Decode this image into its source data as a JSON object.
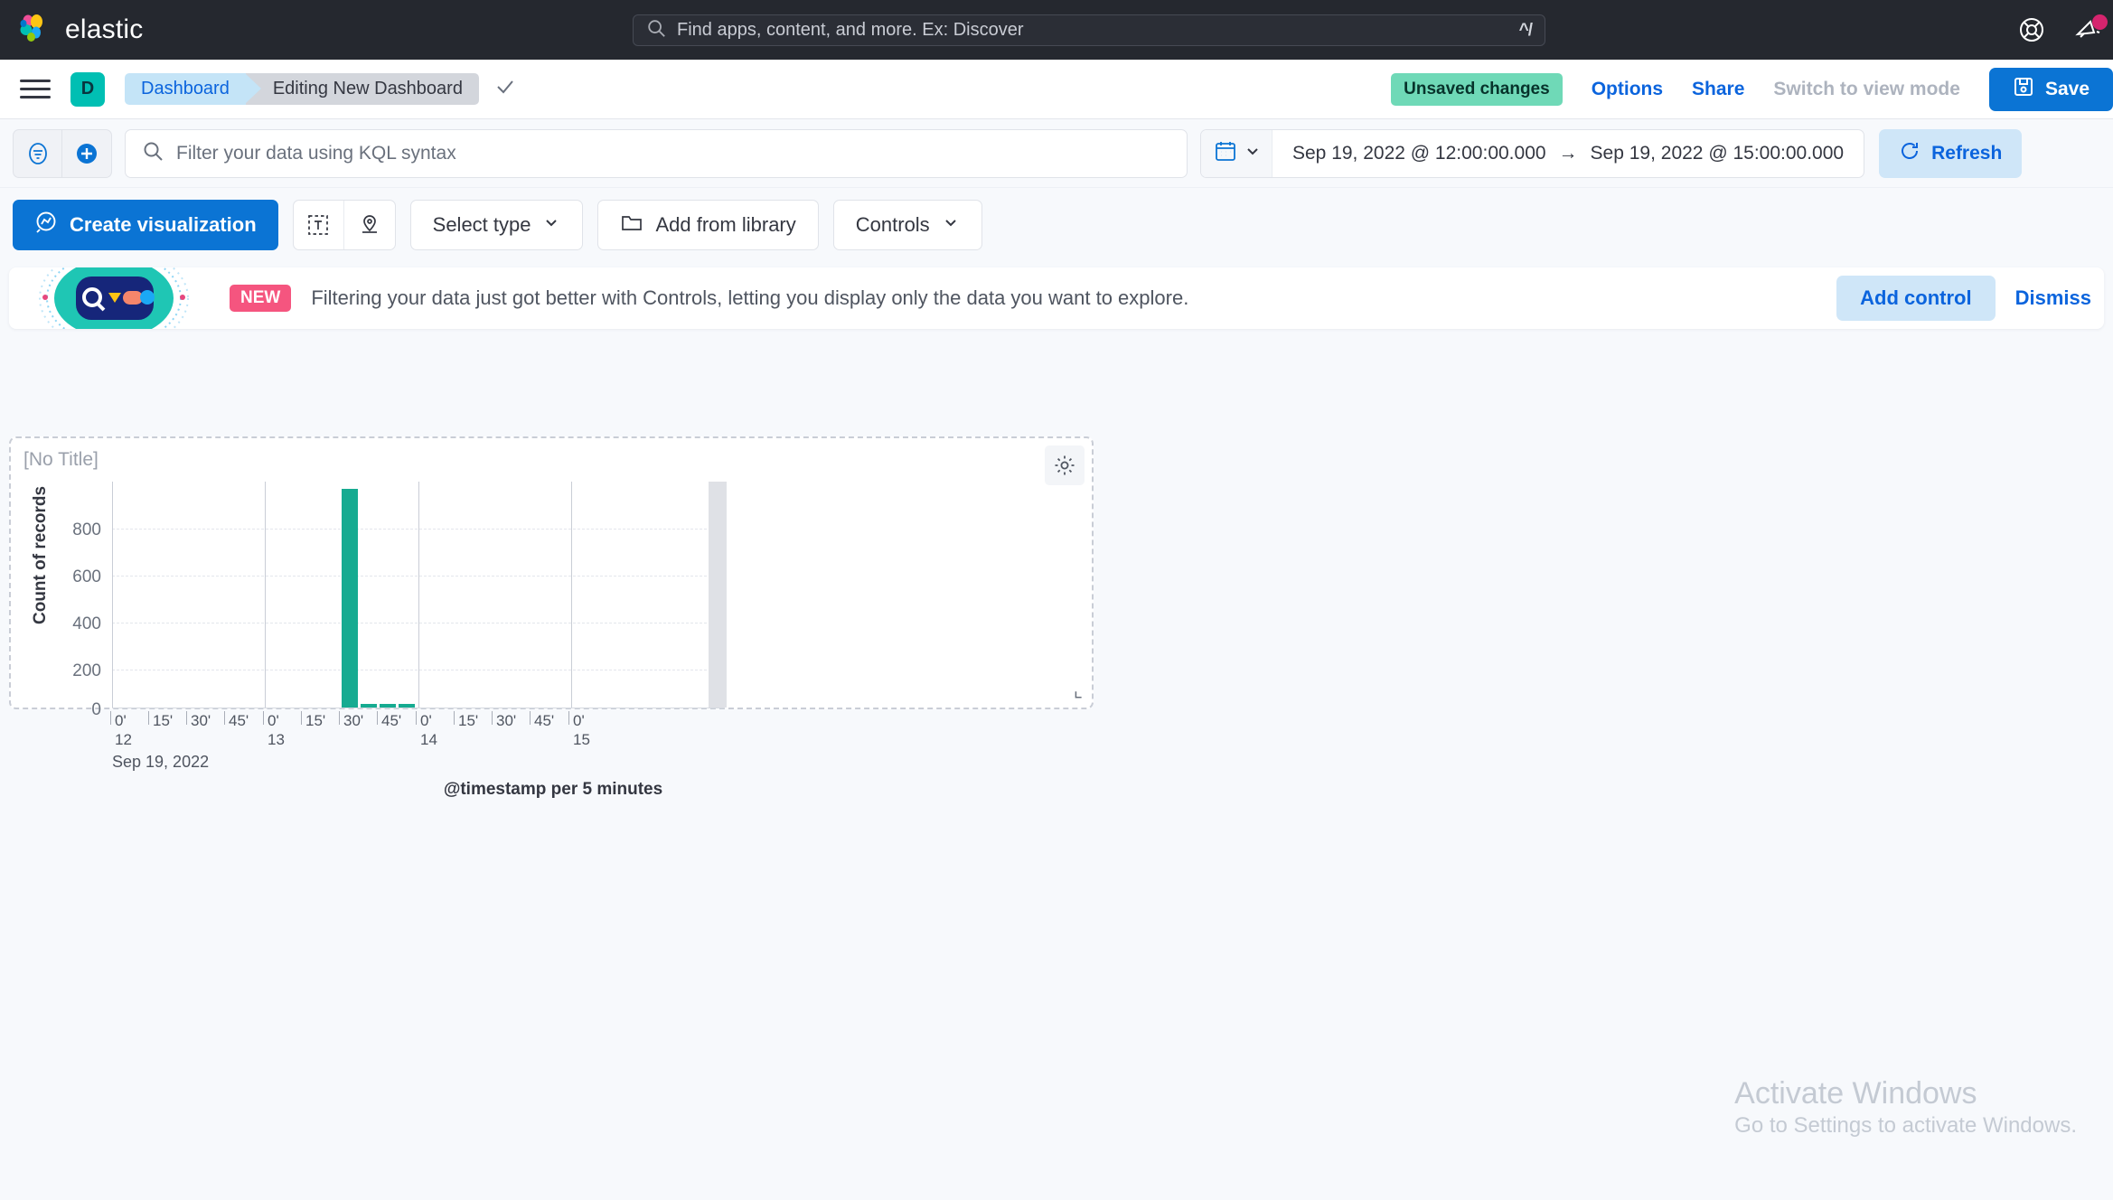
{
  "header": {
    "brand": "elastic",
    "search": {
      "placeholder": "Find apps, content, and more. Ex: Discover",
      "shortcut": "^/",
      "icon": "search-icon"
    },
    "icons": [
      "help-lifebuoy-icon",
      "announcement-megaphone-icon"
    ]
  },
  "breadcrumb": {
    "menu_icon": "hamburger-menu-icon",
    "avatar": "D",
    "items": [
      {
        "label": "Dashboard"
      },
      {
        "label": "Editing New Dashboard"
      }
    ],
    "check_icon": "check-icon",
    "unsaved_label": "Unsaved changes",
    "options_label": "Options",
    "share_label": "Share",
    "view_mode_label": "Switch to view mode",
    "save_label": "Save",
    "save_icon": "save-disk-icon"
  },
  "query_bar": {
    "filter_icon": "filter-icon",
    "add_filter_icon": "add-circle-icon",
    "search_icon": "search-icon",
    "kql_placeholder": "Filter your data using KQL syntax",
    "kql_value": "",
    "calendar_icon": "calendar-icon",
    "date_start": "Sep 19, 2022 @ 12:00:00.000",
    "date_arrow": "→",
    "date_end": "Sep 19, 2022 @ 15:00:00.000",
    "refresh_label": "Refresh",
    "refresh_icon": "refresh-icon"
  },
  "edit_toolbar": {
    "create_visualization_label": "Create visualization",
    "create_visualization_icon": "lens-icon",
    "text_panel_icon": "text-panel-icon",
    "maps_icon": "map-marker-icon",
    "select_type_label": "Select type",
    "add_from_library_label": "Add from library",
    "folder_icon": "folder-icon",
    "controls_label": "Controls",
    "chevron_icon": "chevron-down-icon"
  },
  "callout": {
    "badge": "NEW",
    "message": "Filtering your data just got better with Controls, letting you display only the data you want to explore.",
    "add_control_label": "Add control",
    "dismiss_label": "Dismiss",
    "art_icon": "controls-illustration"
  },
  "panel": {
    "title": "[No Title]",
    "gear_icon": "gear-icon",
    "resize_icon": "resize-handle-icon"
  },
  "chart_data": {
    "type": "bar",
    "title": "",
    "xlabel": "@timestamp per 5 minutes",
    "ylabel": "Count of records",
    "ylim": [
      0,
      960
    ],
    "yticks": [
      0,
      200,
      400,
      600,
      800
    ],
    "ytick_labels": [
      "0",
      "200",
      "400",
      "600",
      "800"
    ],
    "x_date_label": "Sep 19, 2022",
    "xtick_labels": [
      {
        "minor": "0'",
        "major": "12"
      },
      {
        "minor": "15'",
        "major": ""
      },
      {
        "minor": "30'",
        "major": ""
      },
      {
        "minor": "45'",
        "major": ""
      },
      {
        "minor": "0'",
        "major": "13"
      },
      {
        "minor": "15'",
        "major": ""
      },
      {
        "minor": "30'",
        "major": ""
      },
      {
        "minor": "45'",
        "major": ""
      },
      {
        "minor": "0'",
        "major": "14"
      },
      {
        "minor": "15'",
        "major": ""
      },
      {
        "minor": "30'",
        "major": ""
      },
      {
        "minor": "45'",
        "major": ""
      },
      {
        "minor": "0'",
        "major": "15"
      }
    ],
    "bar_color": "#16AB91",
    "grid": true,
    "bars": [
      {
        "x": "13:35",
        "value": 930
      },
      {
        "x": "13:40",
        "value": 14
      },
      {
        "x": "13:45",
        "value": 14
      },
      {
        "x": "13:50",
        "value": 14
      }
    ],
    "cursor_band": {
      "x": "15:00",
      "color": "#DFE1E6"
    }
  },
  "watermark": {
    "title": "Activate Windows",
    "subtitle": "Go to Settings to activate Windows."
  },
  "colors": {
    "header_bg": "#25282F",
    "accent_blue": "#0B74D4",
    "link_blue": "#0B64DD",
    "teal": "#00BFB3",
    "bar_teal": "#16AB91",
    "badge_green": "#6FD9B7",
    "badge_pink": "#F5557F",
    "page_bg": "#F7F9FC"
  }
}
